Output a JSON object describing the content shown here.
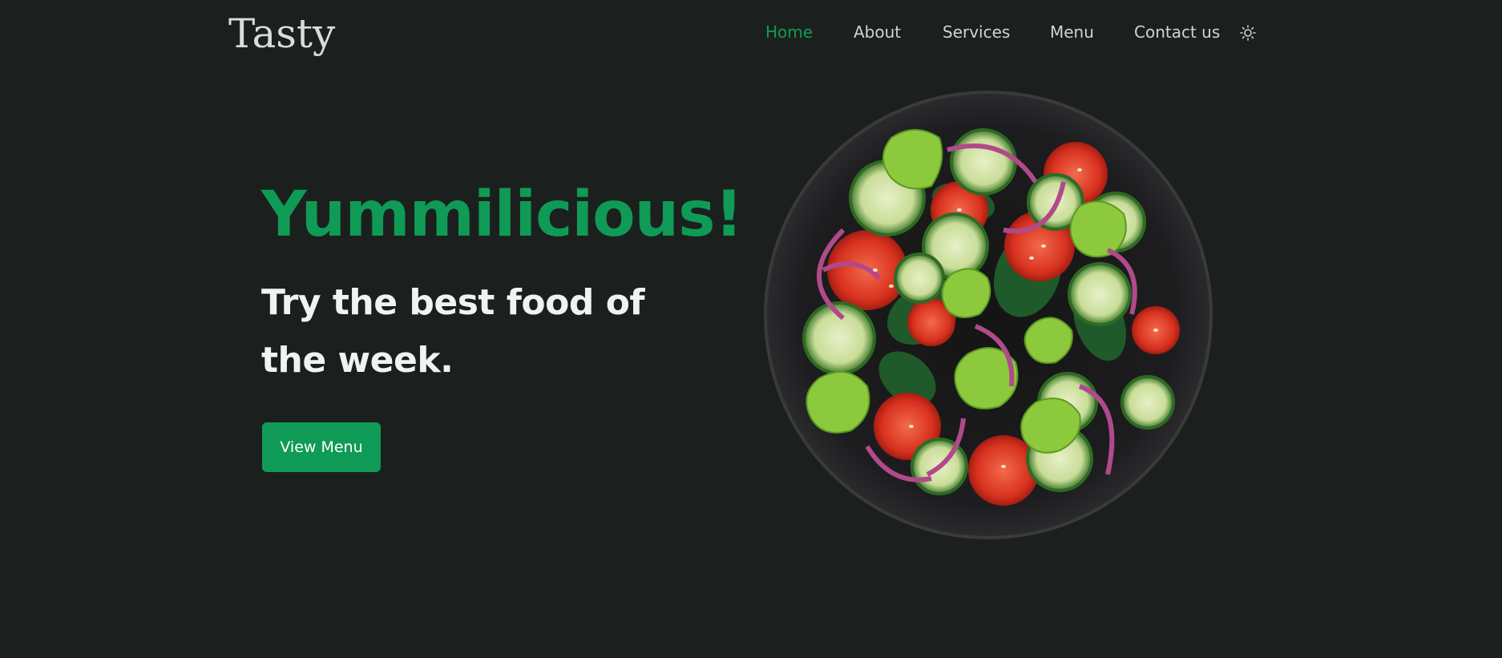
{
  "brand": {
    "logo_text": "Tasty"
  },
  "nav": {
    "items": [
      {
        "label": "Home",
        "active": true
      },
      {
        "label": "About",
        "active": false
      },
      {
        "label": "Services",
        "active": false
      },
      {
        "label": "Menu",
        "active": false
      },
      {
        "label": "Contact us",
        "active": false
      }
    ],
    "theme_toggle_icon": "sun-icon"
  },
  "hero": {
    "title": "Yummilicious!",
    "subtitle": "Try the best food of the week.",
    "cta_label": "View Menu",
    "image": "salad-bowl"
  },
  "colors": {
    "background": "#1b201e",
    "accent": "#0f9b55",
    "nav_text": "#cfd3d1",
    "heading_text": "#f1f3f2"
  }
}
